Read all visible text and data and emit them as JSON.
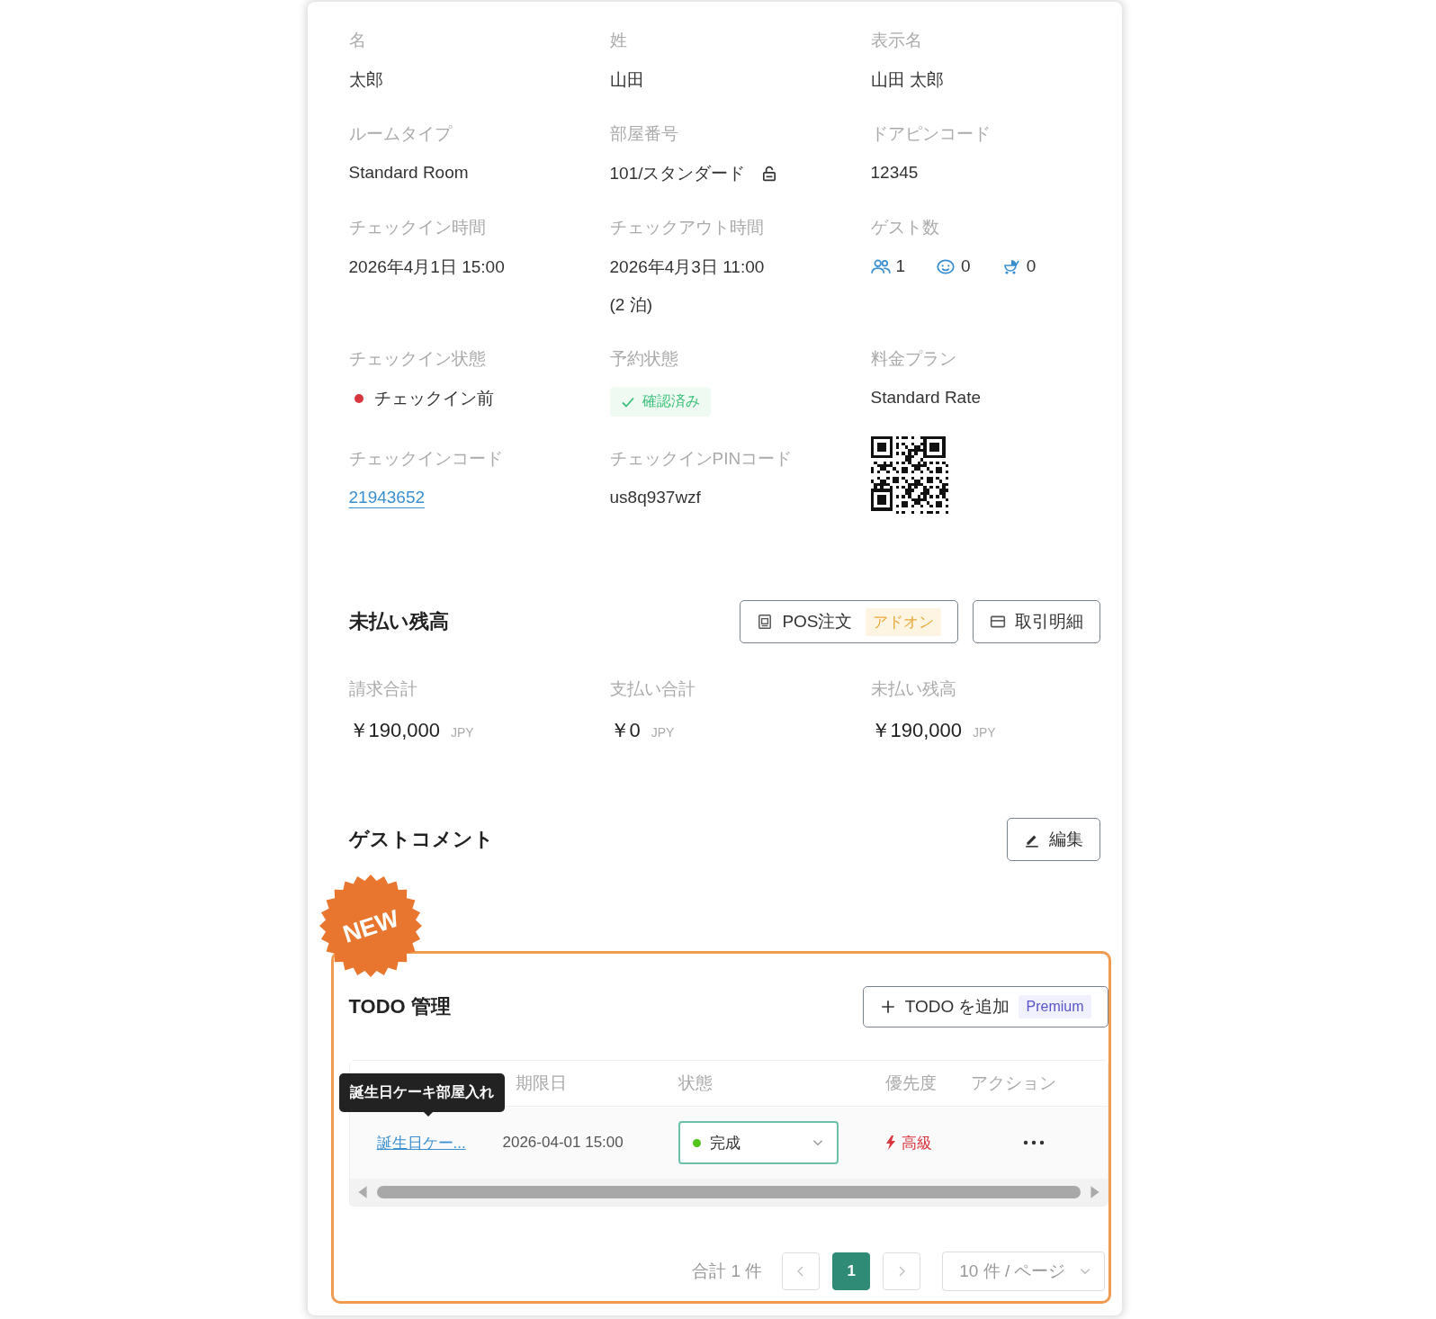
{
  "details": [
    {
      "kind": "text",
      "label": "名",
      "value": "太郎"
    },
    {
      "kind": "text",
      "label": "姓",
      "value": "山田"
    },
    {
      "kind": "text",
      "label": "表示名",
      "value": "山田 太郎"
    },
    {
      "kind": "locked",
      "label": "ルームタイプ",
      "value": "Standard Room"
    },
    {
      "kind": "locked",
      "label": "部屋番号",
      "value": "101/スタンダード",
      "locked": true
    },
    {
      "kind": "text",
      "label": "ドアピンコード",
      "value": "12345"
    },
    {
      "kind": "text",
      "label": "チェックイン時間",
      "value": "2026年4月1日 15:00"
    },
    {
      "kind": "note",
      "label": "チェックアウト時間",
      "value": "2026年4月3日 11:00",
      "note": "(2 泊)"
    },
    {
      "kind": "guests",
      "label": "ゲスト数",
      "guests": [
        {
          "kind": "adult",
          "count": "1"
        },
        {
          "kind": "child",
          "count": "0"
        },
        {
          "kind": "infant",
          "count": "0"
        }
      ]
    },
    {
      "kind": "status",
      "label": "チェックイン状態",
      "value": "チェックイン前",
      "color": "#d9363e"
    },
    {
      "kind": "tag",
      "label": "予約状態",
      "value": "確認済み"
    },
    {
      "kind": "text",
      "label": "料金プラン",
      "value": "Standard Rate"
    },
    {
      "kind": "link",
      "label": "チェックインコード",
      "value": "21943652"
    },
    {
      "kind": "text",
      "label": "チェックインPINコード",
      "value": "us8q937wzf"
    },
    {
      "kind": "qr"
    }
  ],
  "balance": {
    "title": "未払い残高",
    "buttons": [
      {
        "kind": "pos",
        "label": "POS注文",
        "badge": "アドオン"
      },
      {
        "kind": "statement",
        "label": "取引明細"
      }
    ],
    "amounts": [
      {
        "label": "請求合計",
        "amount": "￥190,000",
        "currency": "JPY"
      },
      {
        "label": "支払い合計",
        "amount": "￥0",
        "currency": "JPY"
      },
      {
        "label": "未払い残高",
        "amount": "￥190,000",
        "currency": "JPY"
      }
    ]
  },
  "comment": {
    "title": "ゲストコメント",
    "button": "編集"
  },
  "todo": {
    "badge": "NEW",
    "title": "TODO 管理",
    "add_button": {
      "label": "TODO を追加",
      "badge": "Premium"
    },
    "columns": [
      "期限日",
      "状態",
      "優先度",
      "アクション"
    ],
    "rows": [
      {
        "name": "誕生日ケー...",
        "due": "2026-04-01 15:00",
        "status": "完成",
        "color": "#52c41a",
        "priority": "高級"
      }
    ],
    "tooltip": "誕生日ケーキ部屋入れ",
    "total": "合計 1 件",
    "pages": [
      {
        "label": "1",
        "selected": true
      }
    ],
    "page_size": "10 件 / ページ"
  }
}
